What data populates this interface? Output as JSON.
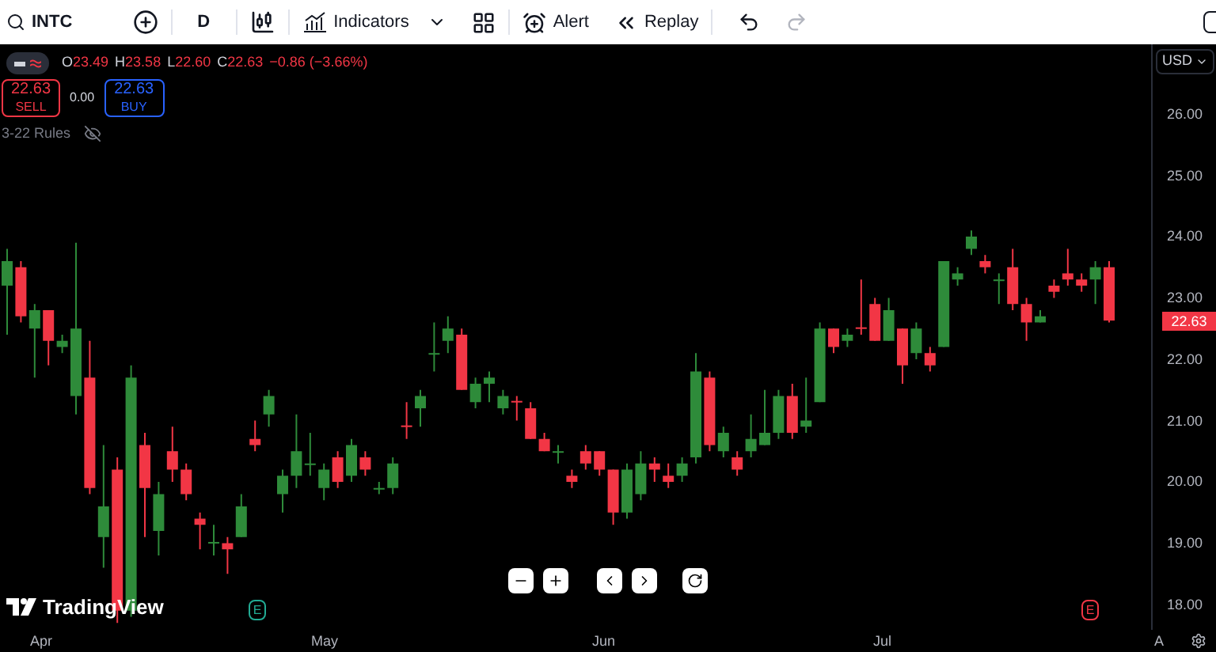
{
  "toolbar": {
    "symbol": "INTC",
    "interval": "D",
    "indicators": "Indicators",
    "alert": "Alert",
    "replay": "Replay",
    "redo_disabled": true
  },
  "legend": {
    "items": [
      {
        "label": "O",
        "value": "23.49"
      },
      {
        "label": "H",
        "value": "23.58"
      },
      {
        "label": "L",
        "value": "22.60"
      },
      {
        "label": "C",
        "value": "22.63"
      }
    ],
    "change": "−0.86 (−3.66%)"
  },
  "trade": {
    "sell_price": "22.63",
    "sell_label": "SELL",
    "spread": "0.00",
    "buy_price": "22.63",
    "buy_label": "BUY"
  },
  "rules": {
    "label": "3-22 Rules"
  },
  "chart": {
    "chart_data": {
      "type": "candlestick",
      "categories": [
        null,
        null,
        null,
        null,
        null,
        null,
        null,
        null,
        null,
        null,
        null,
        null,
        null,
        null,
        null,
        null,
        null,
        null,
        null,
        null,
        null,
        null,
        null,
        null,
        null,
        null,
        null,
        null,
        null,
        null,
        null,
        null,
        null,
        null,
        null,
        null,
        null,
        null,
        null,
        null,
        null,
        null,
        null,
        null,
        null,
        null,
        null,
        null,
        null,
        null,
        null,
        null,
        null,
        null,
        null,
        null,
        null,
        null,
        null,
        null,
        null,
        null,
        null,
        null,
        null,
        null,
        null,
        null,
        null,
        null,
        null,
        null,
        null,
        null,
        null,
        null,
        null,
        null,
        null,
        null,
        null
      ],
      "ylim": [
        17.587,
        27.135
      ],
      "yticks": [
        {
          "value": 26,
          "label": "26.00"
        },
        {
          "value": 25,
          "label": "25.00"
        },
        {
          "value": 24,
          "label": "24.00"
        },
        {
          "value": 23,
          "label": "23.00"
        },
        {
          "value": 22,
          "label": "22.00"
        },
        {
          "value": 21,
          "label": "21.00"
        },
        {
          "value": 20,
          "label": "20.00"
        },
        {
          "value": 19,
          "label": "19.00"
        },
        {
          "value": 18,
          "label": "18.00"
        }
      ],
      "ohlc": [
        [
          23.2,
          23.8,
          22.4,
          23.6
        ],
        [
          23.5,
          23.6,
          22.6,
          22.7
        ],
        [
          22.5,
          22.9,
          21.7,
          22.8
        ],
        [
          22.8,
          22.8,
          21.9,
          22.3
        ],
        [
          22.2,
          22.4,
          22.1,
          22.3
        ],
        [
          21.4,
          23.9,
          21.1,
          22.5
        ],
        [
          21.7,
          22.3,
          19.8,
          19.9
        ],
        [
          19.1,
          20.6,
          18.6,
          19.6
        ],
        [
          20.2,
          20.4,
          17.7,
          17.9
        ],
        [
          17.9,
          21.9,
          17.8,
          21.7
        ],
        [
          20.6,
          20.8,
          19.1,
          19.9
        ],
        [
          19.2,
          20.0,
          18.8,
          19.8
        ],
        [
          20.5,
          20.9,
          20.0,
          20.2
        ],
        [
          20.2,
          20.3,
          19.7,
          19.8
        ],
        [
          19.4,
          19.5,
          18.9,
          19.3
        ],
        [
          19.0,
          19.3,
          18.8,
          19.02
        ],
        [
          19.0,
          19.1,
          18.5,
          18.9
        ],
        [
          19.1,
          19.8,
          19.1,
          19.6
        ],
        [
          20.7,
          21.0,
          20.5,
          20.6
        ],
        [
          21.1,
          21.5,
          20.9,
          21.4
        ],
        [
          19.8,
          20.2,
          19.5,
          20.1
        ],
        [
          20.1,
          21.1,
          19.9,
          20.5
        ],
        [
          20.28,
          20.8,
          20.1,
          20.3
        ],
        [
          19.9,
          20.3,
          19.7,
          20.2
        ],
        [
          20.4,
          20.5,
          19.9,
          20.0
        ],
        [
          20.1,
          20.7,
          20.0,
          20.6
        ],
        [
          20.4,
          20.5,
          20.1,
          20.2
        ],
        [
          19.88,
          20.0,
          19.8,
          19.9
        ],
        [
          19.9,
          20.4,
          19.8,
          20.3
        ],
        [
          20.92,
          21.3,
          20.7,
          20.9
        ],
        [
          21.2,
          21.5,
          20.9,
          21.4
        ],
        [
          22.08,
          22.6,
          21.8,
          22.1
        ],
        [
          22.3,
          22.7,
          22.1,
          22.5
        ],
        [
          22.4,
          22.5,
          21.5,
          21.5
        ],
        [
          21.3,
          21.7,
          21.2,
          21.6
        ],
        [
          21.6,
          21.8,
          21.3,
          21.7
        ],
        [
          21.2,
          21.5,
          21.1,
          21.4
        ],
        [
          21.32,
          21.4,
          21.0,
          21.3
        ],
        [
          21.2,
          21.3,
          20.7,
          20.7
        ],
        [
          20.7,
          20.8,
          20.5,
          20.5
        ],
        [
          20.48,
          20.6,
          20.3,
          20.5
        ],
        [
          20.1,
          20.2,
          19.9,
          20.0
        ],
        [
          20.5,
          20.6,
          20.2,
          20.3
        ],
        [
          20.5,
          20.5,
          20.1,
          20.2
        ],
        [
          20.2,
          20.2,
          19.3,
          19.5
        ],
        [
          19.5,
          20.3,
          19.4,
          20.2
        ],
        [
          19.8,
          20.5,
          19.7,
          20.3
        ],
        [
          20.3,
          20.4,
          20.0,
          20.2
        ],
        [
          20.1,
          20.3,
          19.9,
          20.0
        ],
        [
          20.1,
          20.4,
          20.0,
          20.3
        ],
        [
          20.4,
          22.1,
          20.3,
          21.8
        ],
        [
          21.7,
          21.8,
          20.5,
          20.6
        ],
        [
          20.5,
          20.9,
          20.4,
          20.8
        ],
        [
          20.4,
          20.5,
          20.1,
          20.2
        ],
        [
          20.5,
          21.1,
          20.4,
          20.7
        ],
        [
          20.6,
          21.5,
          20.6,
          20.8
        ],
        [
          20.8,
          21.5,
          20.7,
          21.4
        ],
        [
          21.4,
          21.6,
          20.7,
          20.8
        ],
        [
          20.9,
          21.7,
          20.8,
          21.0
        ],
        [
          21.3,
          22.6,
          21.3,
          22.5
        ],
        [
          22.5,
          22.5,
          22.1,
          22.2
        ],
        [
          22.3,
          22.5,
          22.2,
          22.4
        ],
        [
          22.52,
          23.3,
          22.4,
          22.5
        ],
        [
          22.9,
          23.0,
          22.3,
          22.3
        ],
        [
          22.3,
          23.0,
          22.3,
          22.8
        ],
        [
          22.5,
          22.5,
          21.6,
          21.9
        ],
        [
          22.1,
          22.6,
          22.0,
          22.5
        ],
        [
          22.1,
          22.2,
          21.8,
          21.9
        ],
        [
          22.2,
          23.6,
          22.2,
          23.6
        ],
        [
          23.3,
          23.5,
          23.2,
          23.4
        ],
        [
          23.8,
          24.1,
          23.7,
          24.0
        ],
        [
          23.6,
          23.7,
          23.4,
          23.5
        ],
        [
          23.28,
          23.4,
          22.9,
          23.3
        ],
        [
          23.5,
          23.8,
          22.8,
          22.9
        ],
        [
          22.9,
          23.0,
          22.3,
          22.6
        ],
        [
          22.6,
          22.8,
          22.6,
          22.7
        ],
        [
          23.2,
          23.3,
          23.0,
          23.1
        ],
        [
          23.4,
          23.8,
          23.2,
          23.3
        ],
        [
          23.3,
          23.4,
          23.1,
          23.2
        ],
        [
          23.3,
          23.6,
          22.9,
          23.5
        ],
        [
          23.5,
          23.6,
          22.6,
          22.63
        ]
      ]
    }
  },
  "price_axis": {
    "currency": "USD",
    "last_price": "22.63"
  },
  "time_axis": {
    "labels": [
      "Apr",
      "May",
      "Jun",
      "Jul",
      "A"
    ]
  },
  "logo": "TradingView",
  "events": [
    {
      "label": "E",
      "color": "#22ab94"
    },
    {
      "label": "E",
      "color": "#f23645"
    }
  ]
}
